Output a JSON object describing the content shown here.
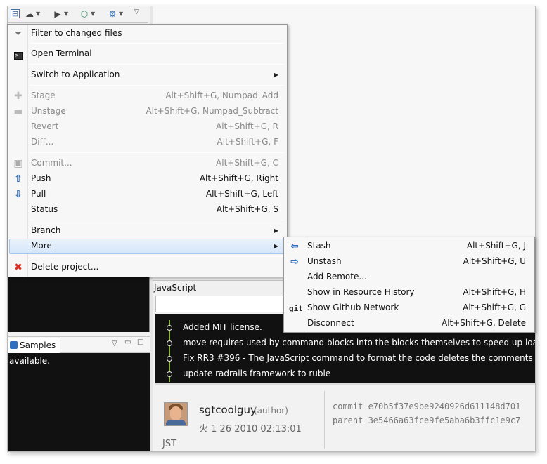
{
  "main_menu": {
    "filter": {
      "label": "Filter to changed files"
    },
    "terminal": {
      "label": "Open Terminal"
    },
    "switch_app": {
      "label": "Switch to Application"
    },
    "stage": {
      "label": "Stage",
      "shortcut": "Alt+Shift+G, Numpad_Add"
    },
    "unstage": {
      "label": "Unstage",
      "shortcut": "Alt+Shift+G, Numpad_Subtract"
    },
    "revert": {
      "label": "Revert",
      "shortcut": "Alt+Shift+G, R"
    },
    "diff": {
      "label": "Diff...",
      "shortcut": "Alt+Shift+G, F"
    },
    "commit": {
      "label": "Commit...",
      "shortcut": "Alt+Shift+G, C"
    },
    "push": {
      "label": "Push",
      "shortcut": "Alt+Shift+G, Right"
    },
    "pull": {
      "label": "Pull",
      "shortcut": "Alt+Shift+G, Left"
    },
    "status": {
      "label": "Status",
      "shortcut": "Alt+Shift+G, S"
    },
    "branch": {
      "label": "Branch"
    },
    "more": {
      "label": "More"
    },
    "delete": {
      "label": "Delete project..."
    }
  },
  "sub_menu": {
    "stash": {
      "label": "Stash",
      "shortcut": "Alt+Shift+G, J"
    },
    "unstash": {
      "label": "Unstash",
      "shortcut": "Alt+Shift+G, U"
    },
    "add_remote": {
      "label": "Add Remote..."
    },
    "resource_history": {
      "label": "Show in Resource History",
      "shortcut": "Alt+Shift+G, H"
    },
    "github_network": {
      "label": "Show Github Network",
      "shortcut": "Alt+Shift+G, G"
    },
    "disconnect": {
      "label": "Disconnect",
      "shortcut": "Alt+Shift+G, Delete"
    }
  },
  "icons": {
    "filter": "funnel-icon",
    "terminal": "terminal-icon",
    "stage": "plus-icon",
    "unstage": "minus-icon",
    "commit": "disk-icon",
    "push": "arrow-up-icon",
    "pull": "arrow-down-icon",
    "delete": "red-x-icon",
    "stash": "arrow-left-icon",
    "unstash": "arrow-right-icon",
    "github": "git-icon"
  },
  "history": {
    "filter_label": "JavaScript",
    "commits": [
      "Added MIT license.",
      "move requires used by command blocks into the blocks themselves to speed up loadin",
      "Fix RR3 #396 - The JavaScript command to format the code deletes the comments",
      "update radrails framework to ruble"
    ],
    "author": "sgtcoolguy",
    "author_role": "(author)",
    "date": "火 1 26 2010 02:13:01",
    "tz": "JST",
    "commit_line": "commit e70b5f37e9be9240926d611148d701",
    "parent_line": "parent 3e5466a63fce9fe5aba6b3ffc1e9c7"
  },
  "samples": {
    "tab_label": "Samples",
    "body_text": "available."
  },
  "colors": {
    "menu_bg": "#f7f7f7",
    "highlight": "#d5e6fa",
    "graph_line": "#8db23a",
    "dark_panel": "#111111",
    "push_arrow": "#2f6fbf",
    "delete_red": "#d93025"
  }
}
